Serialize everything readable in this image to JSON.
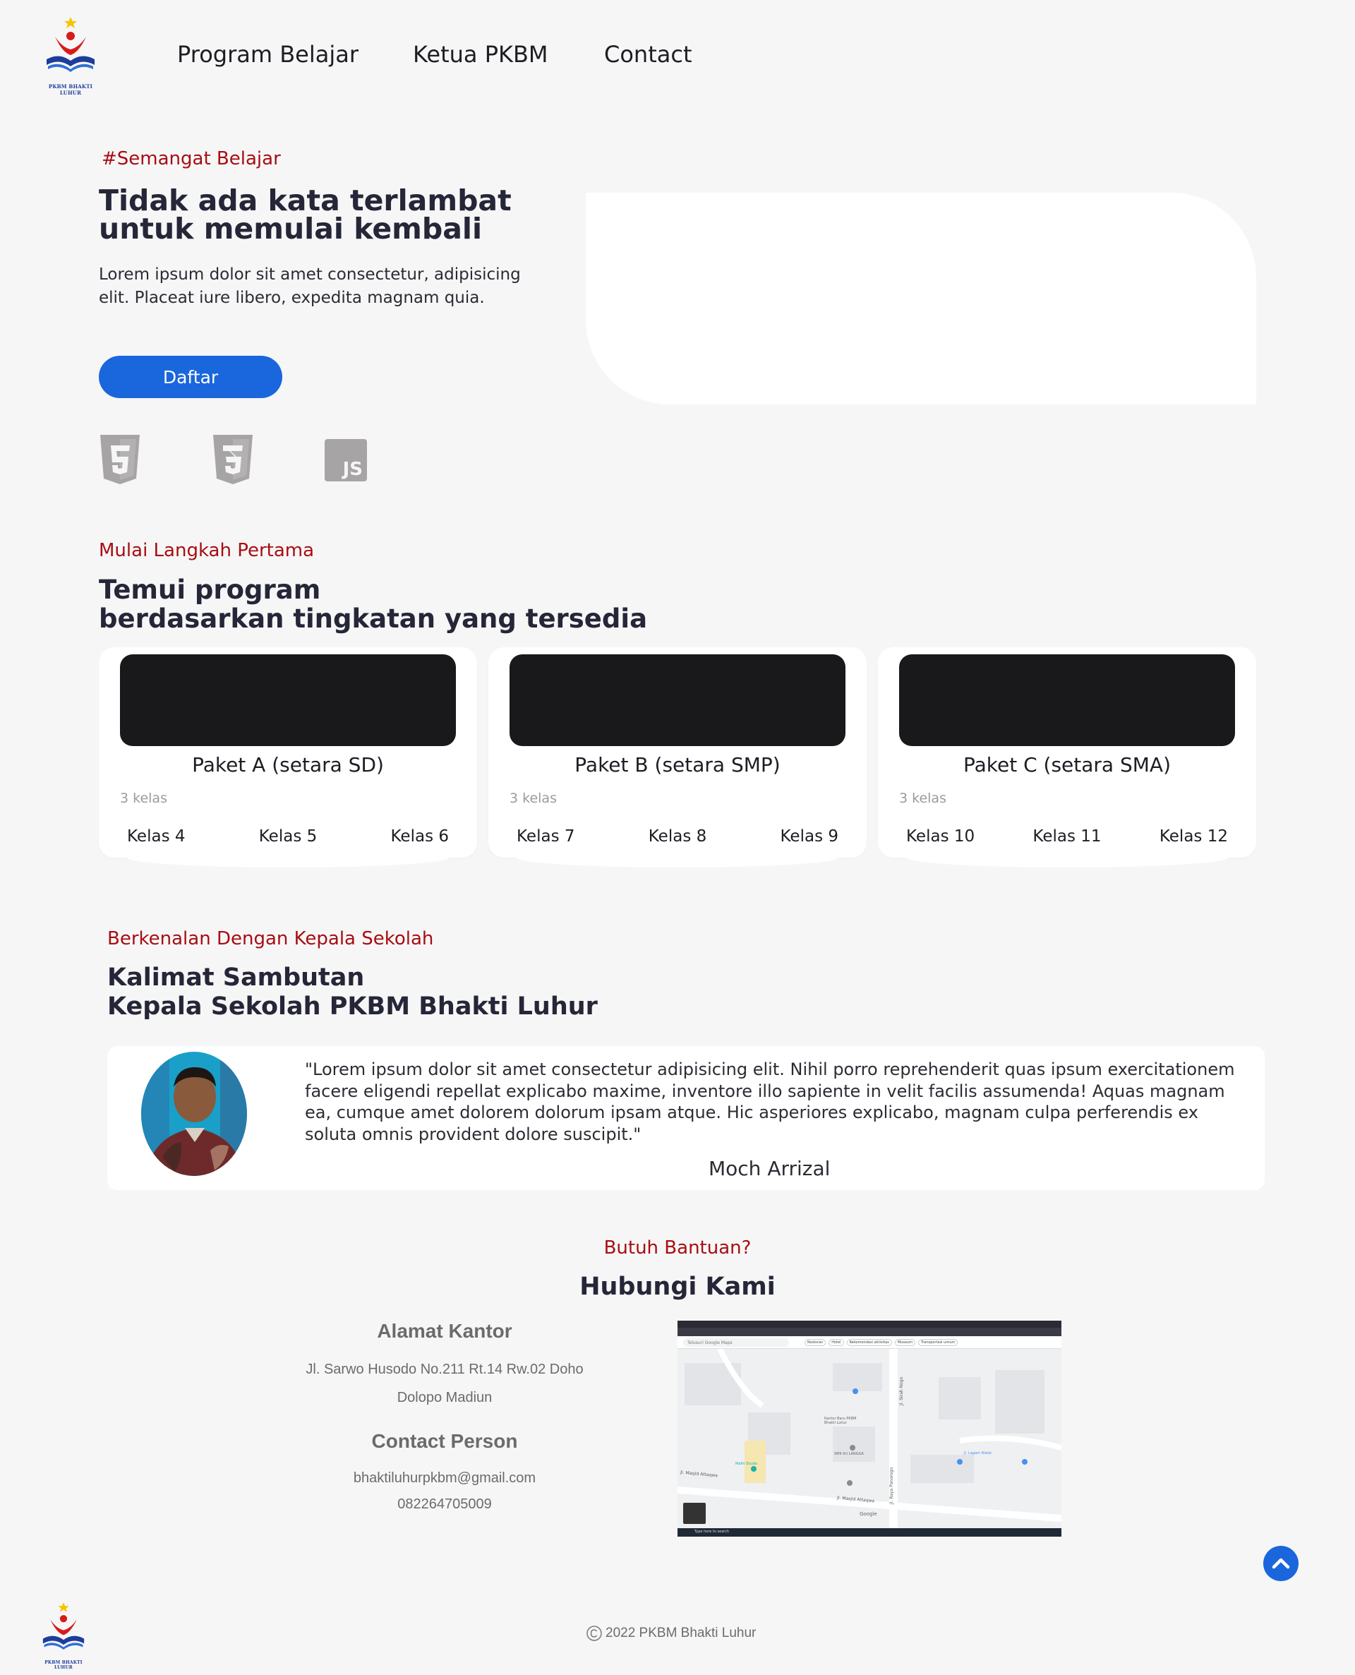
{
  "nav": {
    "logo_caption": "PKBM BHAKTI LUHUR",
    "links": [
      "Program Belajar",
      "Ketua PKBM",
      "Contact"
    ]
  },
  "hero": {
    "tagline": "#Semangat Belajar",
    "title_line1": "Tidak ada kata terlambat",
    "title_line2": "untuk memulai kembali",
    "desc_line1": "Lorem ipsum dolor sit amet consectetur, adipisicing",
    "desc_line2": "elit. Placeat iure libero, expedita magnam quia.",
    "cta_label": "Daftar",
    "tech_icons": [
      "html5-icon",
      "css3-icon",
      "js-icon"
    ],
    "tech_js_label": "JS"
  },
  "programs": {
    "subtitle": "Mulai Langkah Pertama",
    "title_line1": "Temui program",
    "title_line2": "berdasarkan tingkatan yang tersedia",
    "cards": [
      {
        "title": "Paket A (setara SD)",
        "count": "3 kelas",
        "grades": [
          "Kelas 4",
          "Kelas 5",
          "Kelas 6"
        ]
      },
      {
        "title": "Paket B (setara SMP)",
        "count": "3 kelas",
        "grades": [
          "Kelas 7",
          "Kelas 8",
          "Kelas 9"
        ]
      },
      {
        "title": "Paket C (setara SMA)",
        "count": "3 kelas",
        "grades": [
          "Kelas 10",
          "Kelas 11",
          "Kelas 12"
        ]
      }
    ]
  },
  "headmaster": {
    "subtitle": "Berkenalan Dengan Kepala Sekolah",
    "title_line1": "Kalimat Sambutan",
    "title_line2": "Kepala Sekolah PKBM Bhakti Luhur",
    "quote": "\"Lorem ipsum dolor sit amet consectetur adipisicing elit. Nihil porro reprehenderit quas ipsum exercitationem facere eligendi repellat explicabo maxime, inventore illo sapiente in velit facilis assumenda! Aquas magnam ea, cumque amet dolorem dolorum ipsam atque. Hic asperiores explicabo, magnam culpa perferendis ex soluta omnis provident dolore suscipit.\"",
    "name": "Moch Arrizal"
  },
  "contact": {
    "subtitle": "Butuh Bantuan?",
    "title": "Hubungi Kami",
    "office_heading": "Alamat Kantor",
    "office_line1": "Jl. Sarwo Husodo No.211 Rt.14 Rw.02 Doho",
    "office_line2": "Dolopo Madiun",
    "person_heading": "Contact Person",
    "email": "bhaktiluhurpkbm@gmail.com",
    "phone": "082264705009",
    "map": {
      "search_placeholder": "Telusuri Google Maps",
      "chips": [
        "Restoran",
        "Hotel",
        "Rekomendasi aktivitas",
        "Museum",
        "Transportasi umum"
      ],
      "roads": [
        "Jl. Sirah Nogo",
        "Jl. Raya Ponorogo",
        "Jl. Masjid Attaqwa",
        "Jl. Masjid Attaqwa"
      ],
      "places": [
        "Kantor Baru PKBM Bhakti Luhur",
        "SMK Kri LANGGA",
        "Mafin Studio",
        "Jl. Lagam Ristet"
      ],
      "google_label": "Google",
      "taskbar_search": "Type here to search"
    }
  },
  "footer": {
    "copyright": "2022 PKBM Bhakti Luhur"
  },
  "colors": {
    "accent_red": "#a80d12",
    "accent_blue": "#1a66dc",
    "heading": "#252637",
    "background": "#f6f6f7"
  }
}
